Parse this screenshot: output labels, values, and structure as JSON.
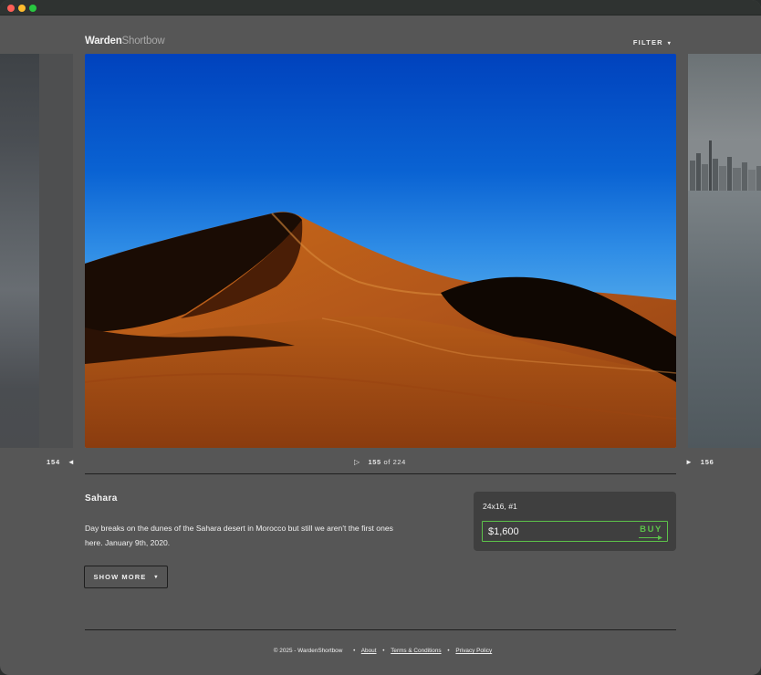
{
  "brand": {
    "name_part1": "Warden",
    "name_part2": "Shortbow"
  },
  "header": {
    "filter_label": "FILTER",
    "filter_caret": "▾"
  },
  "navigation": {
    "prev_number": "154",
    "prev_arrow": "◄",
    "next_number": "156",
    "next_arrow": "►",
    "play_icon": "▷",
    "current": "155",
    "of_label": "of",
    "total": "224"
  },
  "photo": {
    "title": "Sahara",
    "description": "Day breaks on the dunes of the Sahara desert in Morocco but still we aren't the first ones here. January 9th, 2020.",
    "show_more_label": "SHOW MORE",
    "show_more_caret": "▾"
  },
  "purchase": {
    "edition": "24x16, #1",
    "price": "$1,600",
    "buy_label": "BUY"
  },
  "footer": {
    "copyright": "© 2025 - WardenShortbow",
    "separator": "•",
    "links": [
      "About",
      "Terms & Conditions",
      "Privacy Policy"
    ]
  },
  "colors": {
    "background": "#565656",
    "accent_green": "#5cc24a",
    "card": "#3f3f3f",
    "sky_top": "#0046c0",
    "sand": "#b65a12"
  },
  "icons": {
    "filter": "chevron-down-icon",
    "prev": "arrow-left-icon",
    "next": "arrow-right-icon",
    "play": "play-icon",
    "buy": "arrow-right-icon"
  }
}
